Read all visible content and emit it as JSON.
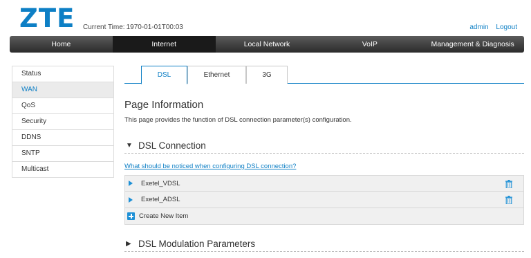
{
  "header": {
    "logo": "ZTE",
    "time_label": "Current Time:",
    "time_value": "1970-01-01T00:03",
    "user": "admin",
    "logout": "Logout"
  },
  "topnav": {
    "items": [
      "Home",
      "Internet",
      "Local Network",
      "VoIP",
      "Management & Diagnosis"
    ],
    "active": "Internet"
  },
  "sidenav": {
    "items": [
      "Status",
      "WAN",
      "QoS",
      "Security",
      "DDNS",
      "SNTP",
      "Multicast"
    ],
    "active": "WAN"
  },
  "tabs": {
    "items": [
      "DSL",
      "Ethernet",
      "3G"
    ],
    "active": "DSL"
  },
  "page": {
    "title": "Page Information",
    "description": "This page provides the function of DSL connection parameter(s) configuration."
  },
  "dsl_connection": {
    "title": "DSL Connection",
    "notice_link": "What should be noticed when configuring DSL connection?",
    "entries": [
      "Exetel_VDSL",
      "Exetel_ADSL"
    ],
    "create_label": "Create New Item"
  },
  "dsl_modulation": {
    "title": "DSL Modulation Parameters"
  },
  "colors": {
    "brand": "#0d7fc5",
    "icon_blue": "#1e90d6",
    "nav_dark": "#2b2b2b"
  },
  "icons": {
    "expanded": "down-triangle-icon",
    "collapsed": "right-triangle-icon",
    "delete": "trash-icon",
    "add": "plus-icon"
  }
}
